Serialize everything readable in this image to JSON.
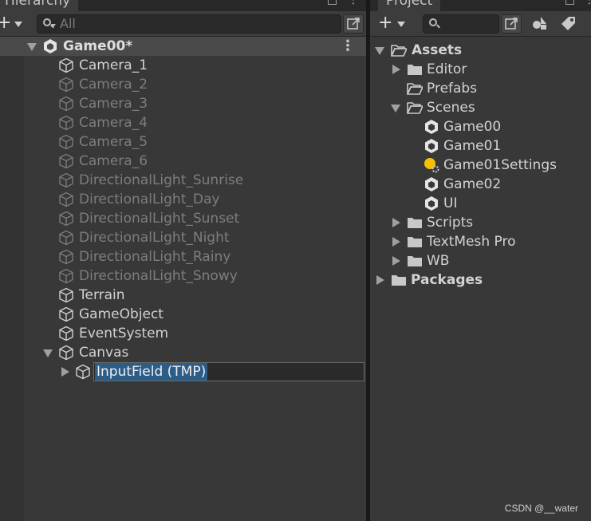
{
  "hierarchy": {
    "tab_label": "Hierarchy",
    "search_placeholder": "All",
    "scene_name": "Game00*",
    "items": [
      {
        "label": "Camera_1",
        "dim": false
      },
      {
        "label": "Camera_2",
        "dim": true
      },
      {
        "label": "Camera_3",
        "dim": true
      },
      {
        "label": "Camera_4",
        "dim": true
      },
      {
        "label": "Camera_5",
        "dim": true
      },
      {
        "label": "Camera_6",
        "dim": true
      },
      {
        "label": "DirectionalLight_Sunrise",
        "dim": true
      },
      {
        "label": "DirectionalLight_Day",
        "dim": true
      },
      {
        "label": "DirectionalLight_Sunset",
        "dim": true
      },
      {
        "label": "DirectionalLight_Night",
        "dim": true
      },
      {
        "label": "DirectionalLight_Rainy",
        "dim": true
      },
      {
        "label": "DirectionalLight_Snowy",
        "dim": true
      },
      {
        "label": "Terrain",
        "dim": false
      },
      {
        "label": "GameObject",
        "dim": false
      },
      {
        "label": "EventSystem",
        "dim": false
      },
      {
        "label": "Canvas",
        "dim": false
      }
    ],
    "child_item": {
      "label": "InputField (TMP)"
    }
  },
  "project": {
    "tab_label": "Project",
    "assets_label": "Assets",
    "folders": [
      {
        "label": "Editor"
      },
      {
        "label": "Prefabs"
      },
      {
        "label": "Scenes"
      }
    ],
    "scene_files": [
      {
        "label": "Game00",
        "icon": "unity-scene-icon"
      },
      {
        "label": "Game01",
        "icon": "unity-scene-icon"
      },
      {
        "label": "Game01Settings",
        "icon": "lighting-settings-icon"
      },
      {
        "label": "Game02",
        "icon": "unity-scene-icon"
      },
      {
        "label": "UI",
        "icon": "unity-scene-icon"
      }
    ],
    "more_folders": [
      {
        "label": "Scripts"
      },
      {
        "label": "TextMesh Pro"
      },
      {
        "label": "WB"
      }
    ],
    "packages_label": "Packages"
  },
  "watermark": "CSDN @__water",
  "colors": {
    "selection": "#2c5d87",
    "panel": "#383838",
    "scene_header": "#4a4a4a"
  }
}
